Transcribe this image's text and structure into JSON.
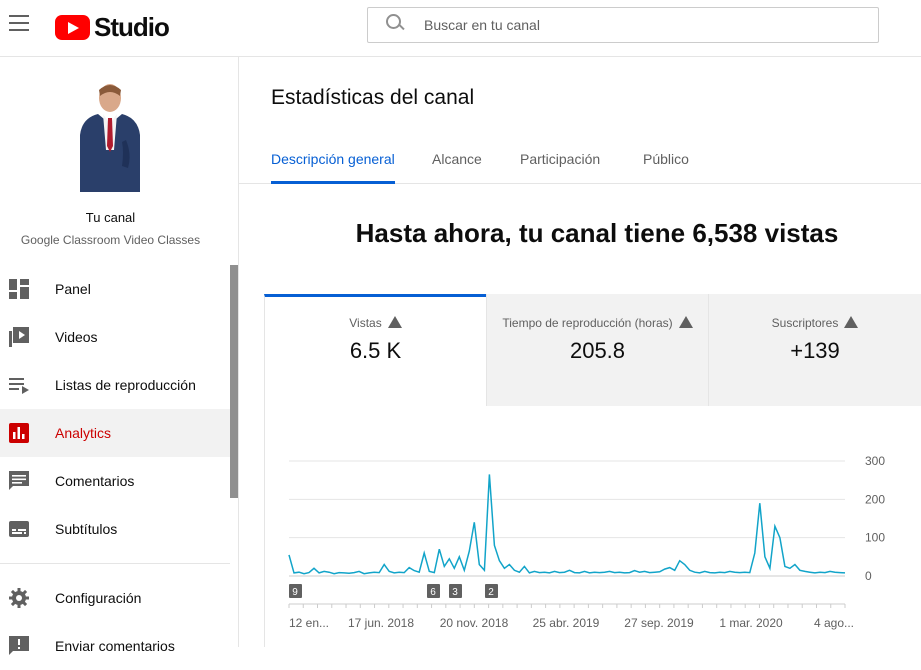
{
  "header": {
    "logo_text": "Studio",
    "search_placeholder": "Buscar en tu canal"
  },
  "sidebar": {
    "channel_name": "Tu canal",
    "channel_subtitle": "Google Classroom Video Classes",
    "items": [
      {
        "label": "Panel",
        "icon": "dashboard-icon"
      },
      {
        "label": "Videos",
        "icon": "video-library-icon"
      },
      {
        "label": "Listas de reproducción",
        "icon": "playlist-icon"
      },
      {
        "label": "Analytics",
        "icon": "analytics-icon",
        "active": true
      },
      {
        "label": "Comentarios",
        "icon": "comments-icon"
      },
      {
        "label": "Subtítulos",
        "icon": "subtitles-icon"
      }
    ],
    "footer_items": [
      {
        "label": "Configuración",
        "icon": "gear-icon"
      },
      {
        "label": "Enviar comentarios",
        "icon": "feedback-icon"
      }
    ]
  },
  "main": {
    "title": "Estadísticas del canal",
    "tabs": [
      {
        "label": "Descripción general",
        "active": true
      },
      {
        "label": "Alcance"
      },
      {
        "label": "Participación"
      },
      {
        "label": "Público"
      }
    ],
    "headline": "Hasta ahora, tu canal tiene 6,538 vistas",
    "metrics": [
      {
        "label": "Vistas",
        "value": "6.5 K",
        "active": true
      },
      {
        "label": "Tiempo de reproducción (horas)",
        "value": "205.8"
      },
      {
        "label": "Suscriptores",
        "value": "+139"
      }
    ]
  },
  "chart_data": {
    "type": "line",
    "series": [
      {
        "values": [
          55,
          8,
          10,
          6,
          9,
          20,
          8,
          12,
          10,
          6,
          9,
          8,
          7,
          9,
          12,
          6,
          8,
          10,
          9,
          30,
          12,
          8,
          10,
          9,
          22,
          14,
          10,
          60,
          12,
          9,
          70,
          25,
          45,
          20,
          50,
          15,
          65,
          140,
          30,
          15,
          265,
          80,
          40,
          20,
          30,
          15,
          10,
          25,
          8,
          12,
          9,
          10,
          8,
          12,
          9,
          10,
          15,
          9,
          8,
          12,
          8,
          10,
          9,
          10,
          12,
          9,
          10,
          8,
          9,
          14,
          10,
          12,
          9,
          10,
          11,
          18,
          22,
          15,
          40,
          30,
          15,
          10,
          8,
          12,
          9,
          8,
          10,
          9,
          12,
          10,
          9,
          10,
          9,
          60,
          190,
          50,
          20,
          130,
          100,
          25,
          20,
          30,
          15,
          12,
          10,
          8,
          10,
          9,
          12,
          10,
          9,
          8
        ]
      }
    ],
    "x_tick_labels": [
      "12 en...",
      "17 jun. 2018",
      "20 nov. 2018",
      "25 abr. 2019",
      "27 sep. 2019",
      "1 mar. 2020",
      "4 ago..."
    ],
    "y_tick_labels": [
      "300",
      "200",
      "100",
      "0"
    ],
    "ylim": [
      0,
      300
    ],
    "markers": [
      "9",
      "6",
      "3",
      "2"
    ],
    "color": "#12a4c9"
  }
}
